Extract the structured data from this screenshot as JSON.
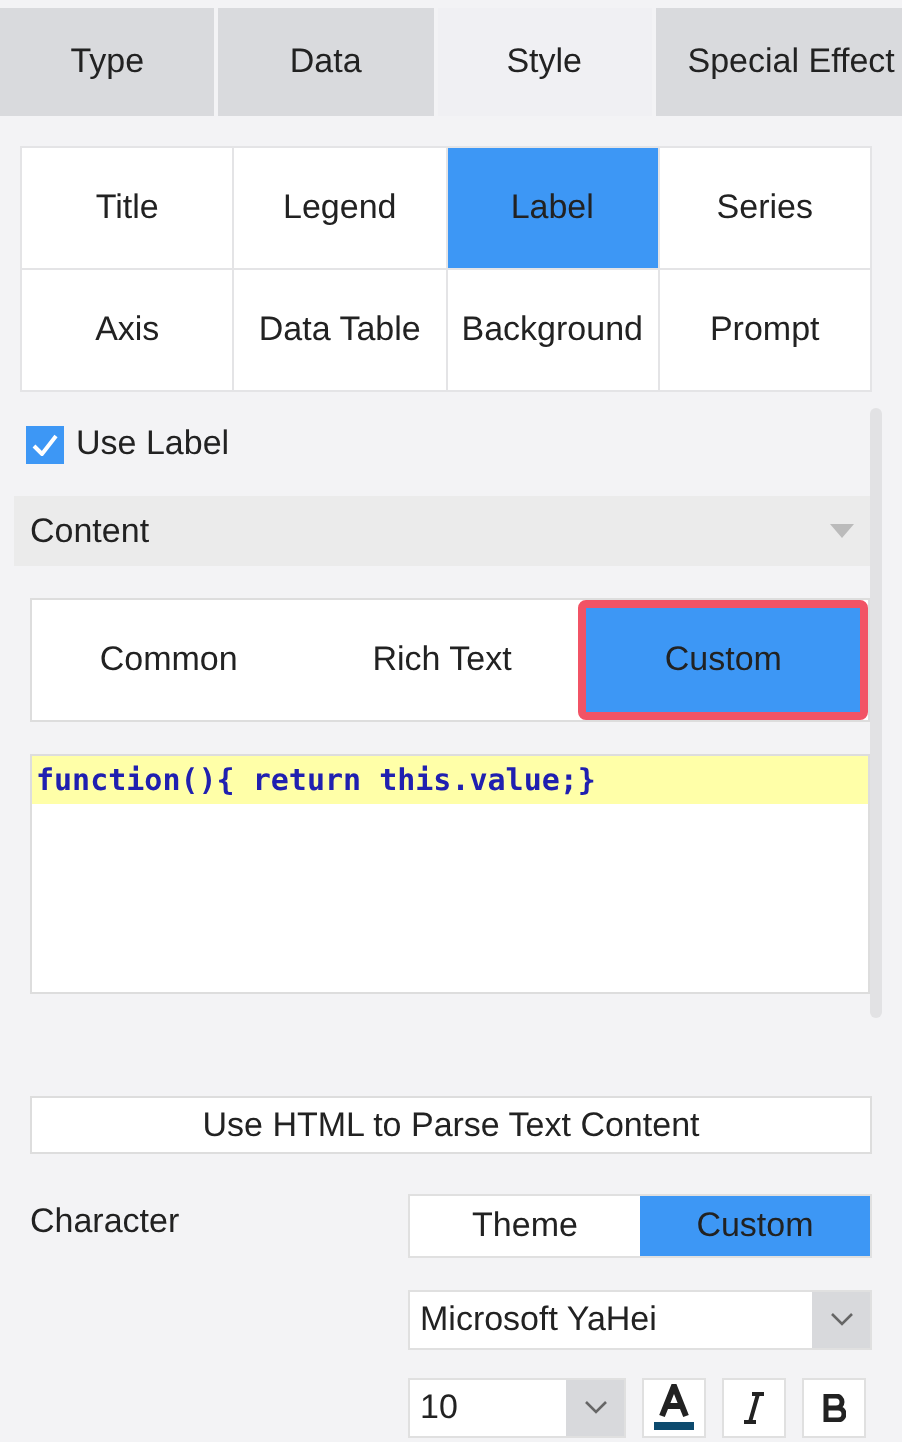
{
  "tabs": [
    {
      "label": "Type",
      "selected": false
    },
    {
      "label": "Data",
      "selected": false
    },
    {
      "label": "Style",
      "selected": true
    },
    {
      "label": "Special Effect",
      "selected": false
    }
  ],
  "style_items": [
    {
      "label": "Title",
      "selected": false
    },
    {
      "label": "Legend",
      "selected": false
    },
    {
      "label": "Label",
      "selected": true
    },
    {
      "label": "Series",
      "selected": false
    },
    {
      "label": "Axis",
      "selected": false
    },
    {
      "label": "Data Table",
      "selected": false
    },
    {
      "label": "Background",
      "selected": false
    },
    {
      "label": "Prompt",
      "selected": false
    }
  ],
  "use_label": {
    "label": "Use Label",
    "checked": true
  },
  "content": {
    "title": "Content"
  },
  "content_modes": [
    {
      "label": "Common",
      "selected": false,
      "highlighted": false
    },
    {
      "label": "Rich Text",
      "selected": false,
      "highlighted": false
    },
    {
      "label": "Custom",
      "selected": true,
      "highlighted": true
    }
  ],
  "code": "function(){ return this.value;}",
  "html_button": "Use HTML to Parse Text Content",
  "character": {
    "label": "Character",
    "modes": [
      {
        "label": "Theme",
        "selected": false
      },
      {
        "label": "Custom",
        "selected": true
      }
    ],
    "font": "Microsoft YaHei",
    "size": "10",
    "italic": false,
    "bold": false
  }
}
